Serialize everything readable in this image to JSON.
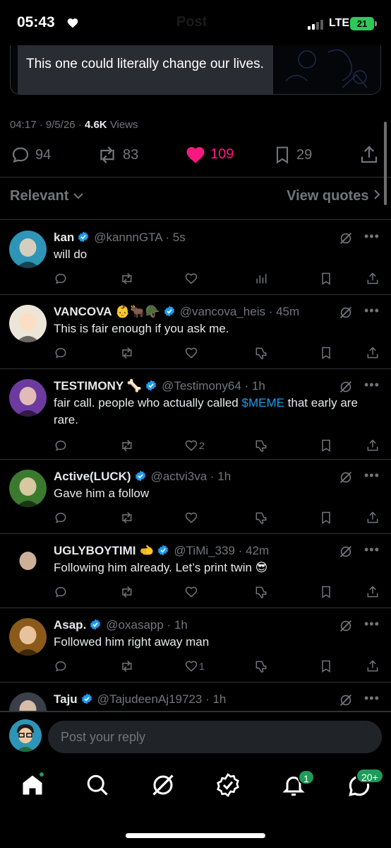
{
  "status": {
    "time": "05:43",
    "title": "Post",
    "network": "LTE",
    "battery": "21"
  },
  "quote": {
    "text": "This one could literally change our lives."
  },
  "post_meta": {
    "time": "04:17",
    "date": "9/5/26",
    "views": "4.6K",
    "views_label": "Views"
  },
  "stats": {
    "replies": "94",
    "reposts": "83",
    "likes": "109",
    "bookmarks": "29"
  },
  "sort": {
    "label": "Relevant",
    "quotes_link": "View quotes"
  },
  "replies": [
    {
      "name": "kan",
      "handle": "@kannnGTA",
      "time": "5s",
      "text": "will do",
      "likes": "",
      "avatar_color": "#2e95b6"
    },
    {
      "name": "VANCOVA",
      "emojis": "👶🐂🪖",
      "handle": "@vancova_heis",
      "time": "45m",
      "text": "This is fair enough if you ask me.",
      "likes": "",
      "avatar_color": "#ece6d8"
    },
    {
      "name": "TESTIMONY",
      "emojis": "🦴",
      "handle": "@Testimony64",
      "time": "1h",
      "text_pre": "fair call. people who actually called ",
      "cashtag": "$MEME",
      "text_post": " that early are rare.",
      "likes": "2",
      "avatar_color": "#6d3aa0"
    },
    {
      "name": "Active(LUCK)",
      "handle": "@actvi3va",
      "time": "1h",
      "text": "Gave him a follow",
      "likes": "",
      "avatar_color": "#3b7a2e"
    },
    {
      "name": "UGLYBOYTIMI",
      "emojis": "🫲",
      "handle": "@TiMi_339",
      "time": "42m",
      "text": "Following him already. Let’s print twin 😎",
      "likes": "",
      "avatar_color": "#000000"
    },
    {
      "name": "Asap.",
      "handle": "@oxasapp",
      "time": "1h",
      "text": "Followed him right away man",
      "likes": "1",
      "avatar_color": "#8a5a1a"
    },
    {
      "name": "Taju",
      "handle": "@TajudeenAj19723",
      "time": "1h",
      "text": "",
      "likes": "",
      "avatar_color": "#3a3f4a"
    }
  ],
  "composer": {
    "placeholder": "Post your reply"
  },
  "tabs": {
    "notifications_badge": "1",
    "messages_badge": "20+"
  },
  "colors": {
    "like": "#f91880",
    "verified": "#1d9bf0",
    "cashtag": "#1d9bf0",
    "badge": "#1d9b59"
  }
}
